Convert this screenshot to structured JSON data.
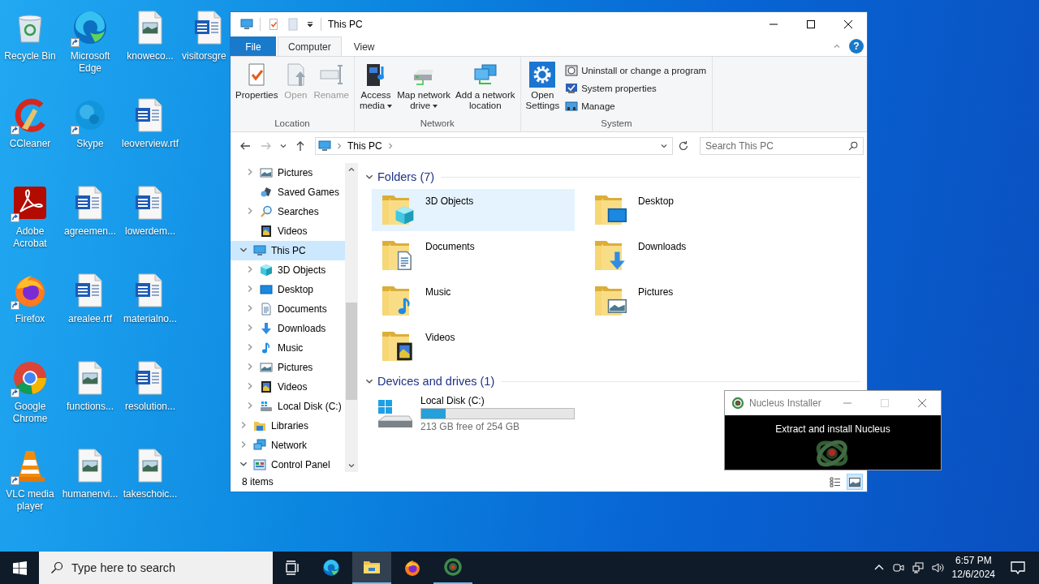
{
  "desktop": {
    "icons": [
      {
        "label": "Recycle Bin",
        "kind": "recycle",
        "shortcut": false
      },
      {
        "label": "CCleaner",
        "kind": "ccleaner",
        "shortcut": true
      },
      {
        "label": "Adobe Acrobat",
        "kind": "acrobat",
        "shortcut": true
      },
      {
        "label": "Firefox",
        "kind": "firefox",
        "shortcut": true
      },
      {
        "label": "Google Chrome",
        "kind": "chrome",
        "shortcut": true
      },
      {
        "label": "VLC media player",
        "kind": "vlc",
        "shortcut": true
      },
      {
        "label": "Microsoft Edge",
        "kind": "edge",
        "shortcut": true
      },
      {
        "label": "Skype",
        "kind": "skype",
        "shortcut": true
      },
      {
        "label": "agreemen...",
        "kind": "word",
        "shortcut": false
      },
      {
        "label": "arealee.rtf",
        "kind": "word",
        "shortcut": false
      },
      {
        "label": "functions...",
        "kind": "image",
        "shortcut": false
      },
      {
        "label": "humanenvi...",
        "kind": "image",
        "shortcut": false
      },
      {
        "label": "knoweco...",
        "kind": "image",
        "shortcut": false
      },
      {
        "label": "leoverview.rtf",
        "kind": "word",
        "shortcut": false
      },
      {
        "label": "lowerdem...",
        "kind": "word",
        "shortcut": false
      },
      {
        "label": "materialno...",
        "kind": "word",
        "shortcut": false
      },
      {
        "label": "resolution...",
        "kind": "word",
        "shortcut": false
      },
      {
        "label": "takeschoic...",
        "kind": "image",
        "shortcut": false
      },
      {
        "label": "visitorsgre",
        "kind": "word",
        "shortcut": false
      }
    ]
  },
  "explorer": {
    "title": "This PC",
    "help": "?",
    "ribbon_tabs": [
      {
        "label": "File",
        "kind": "file",
        "selected": false
      },
      {
        "label": "Computer",
        "kind": "tab",
        "selected": true
      },
      {
        "label": "View",
        "kind": "tab",
        "selected": false
      }
    ],
    "ribbon_groups": [
      {
        "label": "Location",
        "buttons": [
          {
            "lines": [
              "Properties"
            ],
            "kind": "properties",
            "disabled": false,
            "dropdown": false
          },
          {
            "lines": [
              "Open"
            ],
            "kind": "open",
            "disabled": true,
            "dropdown": false
          },
          {
            "lines": [
              "Rename"
            ],
            "kind": "rename",
            "disabled": true,
            "dropdown": false
          }
        ]
      },
      {
        "label": "Network",
        "buttons": [
          {
            "lines": [
              "Access",
              "media"
            ],
            "kind": "media",
            "disabled": false,
            "dropdown": true
          },
          {
            "lines": [
              "Map network",
              "drive"
            ],
            "kind": "drive",
            "disabled": false,
            "dropdown": true
          },
          {
            "lines": [
              "Add a network",
              "location"
            ],
            "kind": "netloc",
            "disabled": false,
            "dropdown": false
          }
        ]
      },
      {
        "label": "System",
        "buttons": [
          {
            "lines": [
              "Open",
              "Settings"
            ],
            "kind": "settings",
            "disabled": false,
            "dropdown": false
          }
        ],
        "small_buttons": [
          {
            "label": "Uninstall or change a program",
            "kind": "uninstall"
          },
          {
            "label": "System properties",
            "kind": "sysprops"
          },
          {
            "label": "Manage",
            "kind": "manage"
          }
        ]
      }
    ],
    "address": {
      "path": [
        "This PC"
      ],
      "search_placeholder": "Search This PC"
    },
    "nav_tree": [
      {
        "children": [
          {
            "label": "Pictures",
            "kind": "pictures",
            "expandable": true,
            "expanded": false,
            "selected": false
          },
          {
            "label": "Saved Games",
            "kind": "games",
            "expandable": false,
            "selected": false
          },
          {
            "label": "Searches",
            "kind": "search",
            "expandable": true,
            "expanded": false,
            "selected": false
          },
          {
            "label": "Videos",
            "kind": "videos",
            "expandable": false,
            "selected": false
          }
        ]
      },
      {
        "label": "This PC",
        "kind": "pc",
        "expandable": true,
        "expanded": true,
        "selected": true,
        "children": [
          {
            "label": "3D Objects",
            "kind": "cube",
            "expandable": true,
            "expanded": false,
            "selected": false
          },
          {
            "label": "Desktop",
            "kind": "desktop",
            "expandable": true,
            "expanded": false,
            "selected": false
          },
          {
            "label": "Documents",
            "kind": "documents",
            "expandable": true,
            "expanded": false,
            "selected": false
          },
          {
            "label": "Downloads",
            "kind": "downloads",
            "expandable": true,
            "expanded": false,
            "selected": false
          },
          {
            "label": "Music",
            "kind": "music",
            "expandable": true,
            "expanded": false,
            "selected": false
          },
          {
            "label": "Pictures",
            "kind": "pictures",
            "expandable": true,
            "expanded": false,
            "selected": false
          },
          {
            "label": "Videos",
            "kind": "videos",
            "expandable": true,
            "expanded": false,
            "selected": false
          },
          {
            "label": "Local Disk (C:)",
            "kind": "disk",
            "expandable": true,
            "expanded": false,
            "selected": false
          }
        ]
      },
      {
        "label": "Libraries",
        "kind": "libraries",
        "expandable": true,
        "expanded": false,
        "selected": false
      },
      {
        "label": "Network",
        "kind": "network",
        "expandable": true,
        "expanded": false,
        "selected": false
      },
      {
        "label": "Control Panel",
        "kind": "control",
        "expandable": true,
        "expanded": true,
        "selected": false
      }
    ],
    "sections": [
      {
        "label": "Folders (7)",
        "kind": "folders",
        "expanded": true,
        "items": [
          {
            "label": "3D Objects",
            "kind": "cube",
            "selected": true
          },
          {
            "label": "Desktop",
            "kind": "desktop",
            "selected": false
          },
          {
            "label": "Documents",
            "kind": "documents",
            "selected": false
          },
          {
            "label": "Downloads",
            "kind": "downloads",
            "selected": false
          },
          {
            "label": "Music",
            "kind": "music",
            "selected": false
          },
          {
            "label": "Pictures",
            "kind": "pictures",
            "selected": false
          },
          {
            "label": "Videos",
            "kind": "videos",
            "selected": false
          }
        ]
      },
      {
        "label": "Devices and drives (1)",
        "kind": "drives",
        "expanded": true,
        "items": [
          {
            "label": "Local Disk (C:)",
            "kind": "disk",
            "selected": false,
            "level": 0.16,
            "free": "213 GB free of 254 GB"
          }
        ]
      }
    ],
    "status": {
      "count": "8 items",
      "views": [
        {
          "kind": "details",
          "selected": false
        },
        {
          "kind": "large",
          "selected": true
        }
      ]
    }
  },
  "installer": {
    "title": "Nucleus Installer",
    "message": "Extract and install Nucleus",
    "maximize_disabled": true
  },
  "taskbar": {
    "search_placeholder": "Type here to search",
    "apps": [
      {
        "kind": "edge",
        "selected": false,
        "running": false
      },
      {
        "kind": "explorer",
        "selected": true,
        "running": true
      },
      {
        "kind": "firefox",
        "selected": false,
        "running": false
      },
      {
        "kind": "nucleus",
        "selected": false,
        "running": true
      }
    ],
    "time": "6:57 PM",
    "date": "12/6/2024"
  }
}
